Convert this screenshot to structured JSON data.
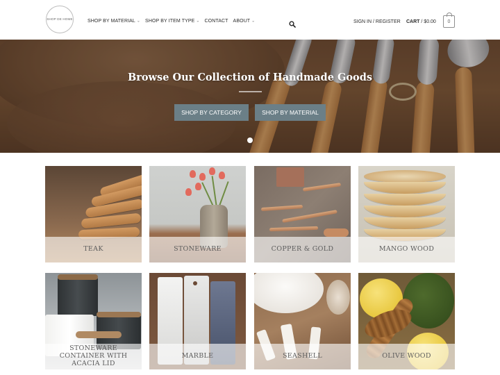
{
  "header": {
    "logo_text": "SHOP DE HOME",
    "nav": [
      {
        "label": "SHOP BY MATERIAL",
        "has_dropdown": true
      },
      {
        "label": "SHOP BY ITEM TYPE",
        "has_dropdown": true
      },
      {
        "label": "CONTACT",
        "has_dropdown": false
      },
      {
        "label": "ABOUT",
        "has_dropdown": true
      }
    ],
    "search_icon": "search-icon",
    "account_label": "SIGN IN / REGISTER",
    "cart_label": "CART",
    "cart_separator": " / ",
    "cart_total": "$0.00",
    "cart_count": "0"
  },
  "hero": {
    "title": "Browse Our Collection of Handmade Goods",
    "buttons": [
      {
        "label": "SHOP BY CATEGORY"
      },
      {
        "label": "SHOP BY MATERIAL"
      }
    ],
    "slides_count": 1,
    "active_slide": 1
  },
  "categories": [
    {
      "label": "TEAK"
    },
    {
      "label": "STONEWARE"
    },
    {
      "label": "COPPER & GOLD"
    },
    {
      "label": "MANGO WOOD"
    },
    {
      "label": "STONEWARE CONTAINER WITH ACACIA LID"
    },
    {
      "label": "MARBLE"
    },
    {
      "label": "SEASHELL"
    },
    {
      "label": "OLIVE WOOD"
    }
  ],
  "colors": {
    "hero_button": "#6b7f87",
    "label_overlay": "rgba(255,255,255,0.62)",
    "text_dark": "#2b2b2b"
  }
}
